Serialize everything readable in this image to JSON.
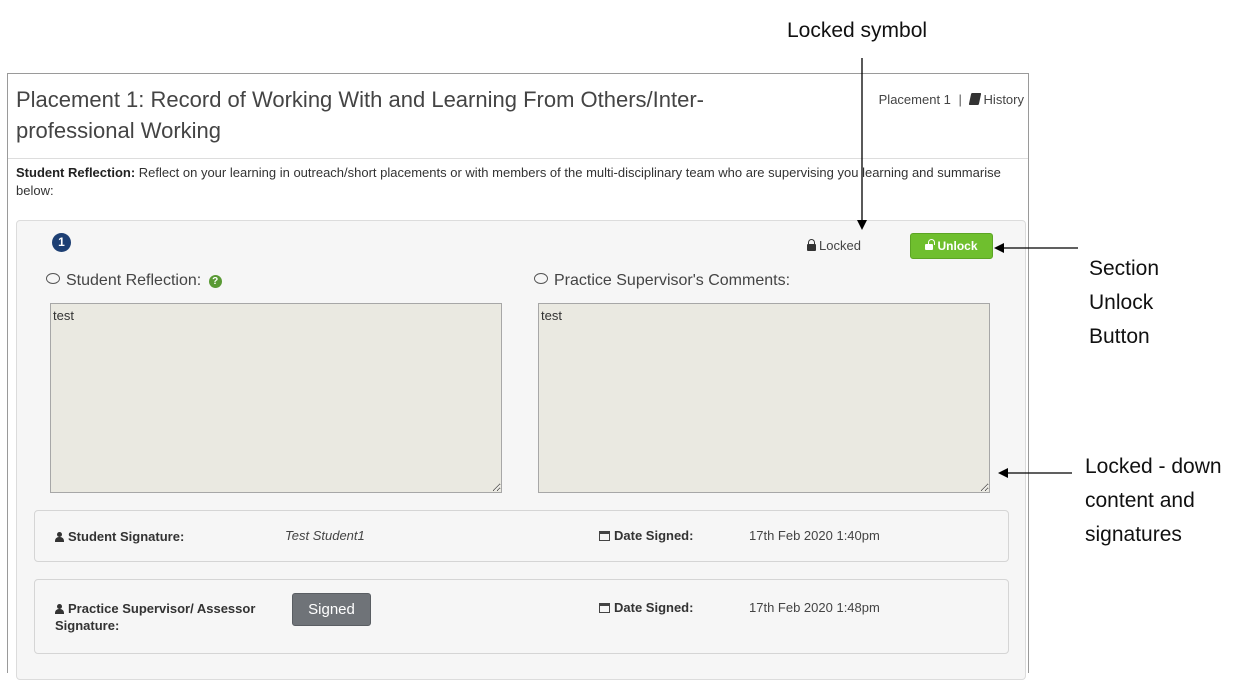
{
  "annotations": {
    "locked_symbol": "Locked symbol",
    "unlock_button": "Section Unlock Button",
    "locked_content": "Locked - down content and signatures"
  },
  "header": {
    "title": "Placement 1: Record of Working With and Learning From Others/Inter-professional Working",
    "breadcrumb": "Placement 1",
    "separator": "|",
    "history_label": "History",
    "history_icon": "book-icon"
  },
  "intro": {
    "label": "Student Reflection:",
    "text": "Reflect on your learning in outreach/short placements or with members of the multi-disciplinary team who are supervising you learning and summarise below:"
  },
  "section": {
    "number": "1",
    "lock_status": "Locked",
    "unlock_label": "Unlock",
    "student_reflection_label": "Student Reflection:",
    "student_reflection_value": "test",
    "supervisor_comments_label": "Practice Supervisor's Comments:",
    "supervisor_comments_value": "test",
    "colors": {
      "badge": "#1d3f73",
      "unlock_button": "#6fbf2e",
      "textarea_bg": "#eae9e1",
      "signed_button": "#6f7378"
    }
  },
  "signatures": {
    "student": {
      "label": "Student Signature:",
      "name": "Test Student1",
      "date_label": "Date Signed:",
      "date_value": "17th Feb 2020 1:40pm"
    },
    "supervisor": {
      "label": "Practice Supervisor/ Assessor Signature:",
      "signed_label": "Signed",
      "date_label": "Date Signed:",
      "date_value": "17th Feb 2020 1:48pm"
    }
  }
}
